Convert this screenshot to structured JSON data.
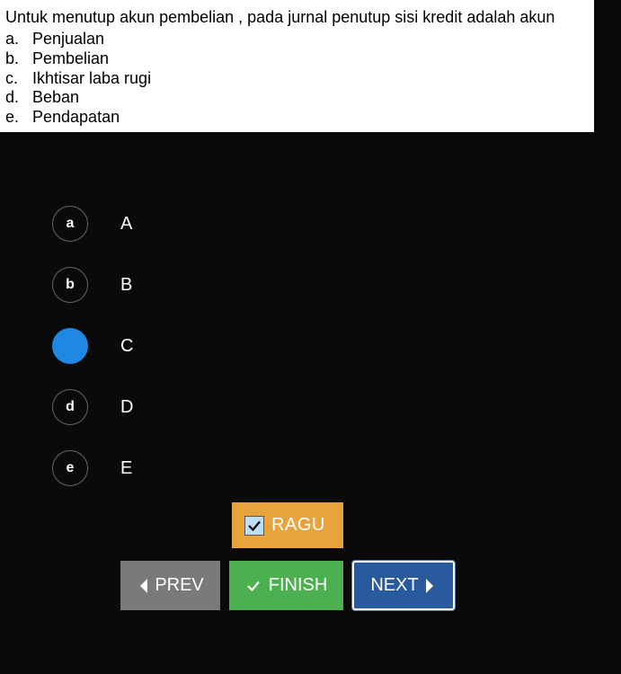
{
  "question": {
    "text": "Untuk menutup akun pembelian , pada jurnal penutup sisi kredit adalah akun",
    "options": [
      {
        "letter": "a.",
        "text": "Penjualan"
      },
      {
        "letter": "b.",
        "text": "Pembelian"
      },
      {
        "letter": "c.",
        "text": "Ikhtisar laba rugi"
      },
      {
        "letter": "d.",
        "text": "Beban"
      },
      {
        "letter": "e.",
        "text": "Pendapatan"
      }
    ]
  },
  "answers": [
    {
      "key": "a",
      "label": "A",
      "selected": false
    },
    {
      "key": "b",
      "label": "B",
      "selected": false
    },
    {
      "key": "c",
      "label": "C",
      "selected": true
    },
    {
      "key": "d",
      "label": "D",
      "selected": false
    },
    {
      "key": "e",
      "label": "E",
      "selected": false
    }
  ],
  "ragu": {
    "label": "RAGU",
    "checked": true
  },
  "nav": {
    "prev": "PREV",
    "finish": "FINISH",
    "next": "NEXT"
  }
}
